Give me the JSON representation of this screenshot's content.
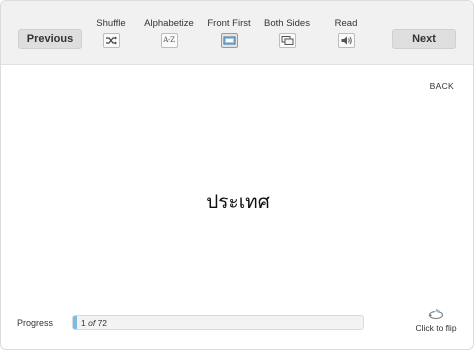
{
  "toolbar": {
    "previous_label": "Previous",
    "next_label": "Next",
    "tools": {
      "shuffle": {
        "label": "Shuffle",
        "icon": "shuffle-icon",
        "active": false
      },
      "alphabetize": {
        "label": "Alphabetize",
        "icon": "a-z-icon",
        "icon_text": "A-Z",
        "active": false
      },
      "front_first": {
        "label": "Front First",
        "icon": "front-first-icon",
        "active": true
      },
      "both_sides": {
        "label": "Both Sides",
        "icon": "both-sides-icon",
        "active": false
      },
      "read": {
        "label": "Read",
        "icon": "speaker-icon",
        "active": false
      }
    }
  },
  "card": {
    "side_label": "BACK",
    "text": "ประเทศ"
  },
  "progress": {
    "label": "Progress",
    "current": "1",
    "of_label": "of",
    "total": "72",
    "fraction": 0.014
  },
  "flip": {
    "label": "Click to flip",
    "icon": "flip-icon"
  },
  "colors": {
    "toolbar_bg": "#f1f1f1",
    "button_bg": "#dedede",
    "progress_fill": "#7fbbe0"
  }
}
